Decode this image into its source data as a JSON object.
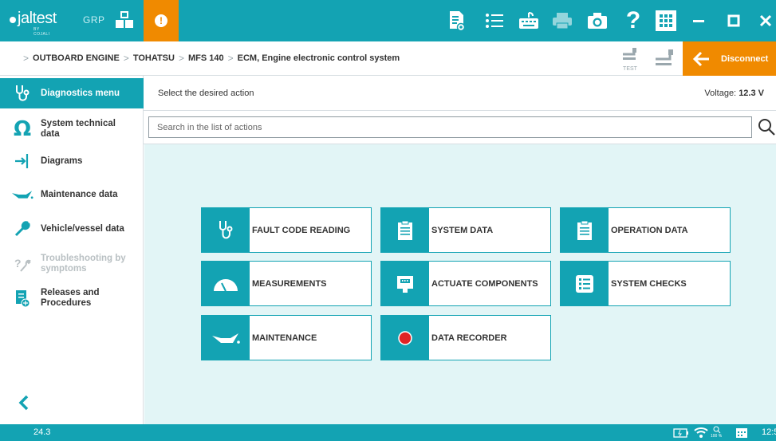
{
  "app": {
    "logo_brand": "jal",
    "logo_suffix": "test",
    "logo_by": "BY COJALI",
    "group_label": "GRP",
    "alert_symbol": "!",
    "accent_color": "#13a3b3",
    "warning_color": "#f08a00"
  },
  "toolbar": {
    "icons": [
      "report-icon",
      "list-icon",
      "keyboard-icon",
      "printer-icon",
      "camera-icon",
      "help-icon",
      "apps-grid-icon"
    ],
    "window_controls": [
      "minimize-icon",
      "maximize-icon",
      "close-icon"
    ]
  },
  "breadcrumb": {
    "items": [
      "OUTBOARD ENGINE",
      "TOHATSU",
      "MFS 140",
      "ECM, Engine electronic control system"
    ]
  },
  "connection": {
    "test_label": "TEST",
    "disconnect_label": "Disconnect"
  },
  "sidebar": {
    "items": [
      {
        "label": "Diagnostics menu",
        "icon": "stethoscope-icon",
        "active": true
      },
      {
        "label": "System technical data",
        "icon": "ohm-icon"
      },
      {
        "label": "Diagrams",
        "icon": "diagram-icon"
      },
      {
        "label": "Maintenance data",
        "icon": "oil-can-icon"
      },
      {
        "label": "Vehicle/vessel data",
        "icon": "wrench-icon"
      },
      {
        "label": "Troubleshooting by symptoms",
        "icon": "troubleshoot-icon",
        "disabled": true
      },
      {
        "label": "Releases and Procedures",
        "icon": "releases-icon"
      }
    ],
    "back_icon": "chevron-left-icon"
  },
  "main": {
    "prompt": "Select the desired action",
    "voltage_label": "Voltage:",
    "voltage_value": "12.3 V",
    "search_placeholder": "Search in the list of actions",
    "actions": [
      {
        "label": "FAULT CODE READING",
        "icon": "stethoscope-icon"
      },
      {
        "label": "SYSTEM DATA",
        "icon": "clipboard-icon"
      },
      {
        "label": "OPERATION DATA",
        "icon": "clipboard-icon"
      },
      {
        "label": "MEASUREMENTS",
        "icon": "gauge-icon"
      },
      {
        "label": "ACTUATE COMPONENTS",
        "icon": "actuator-icon"
      },
      {
        "label": "SYSTEM CHECKS",
        "icon": "checklist-icon"
      },
      {
        "label": "MAINTENANCE",
        "icon": "oil-can-icon"
      },
      {
        "label": "DATA RECORDER",
        "icon": "record-icon",
        "icon_color": "#e02424"
      }
    ]
  },
  "statusbar": {
    "version": "24.3",
    "zoom": "100 %",
    "clock": "12:5"
  }
}
